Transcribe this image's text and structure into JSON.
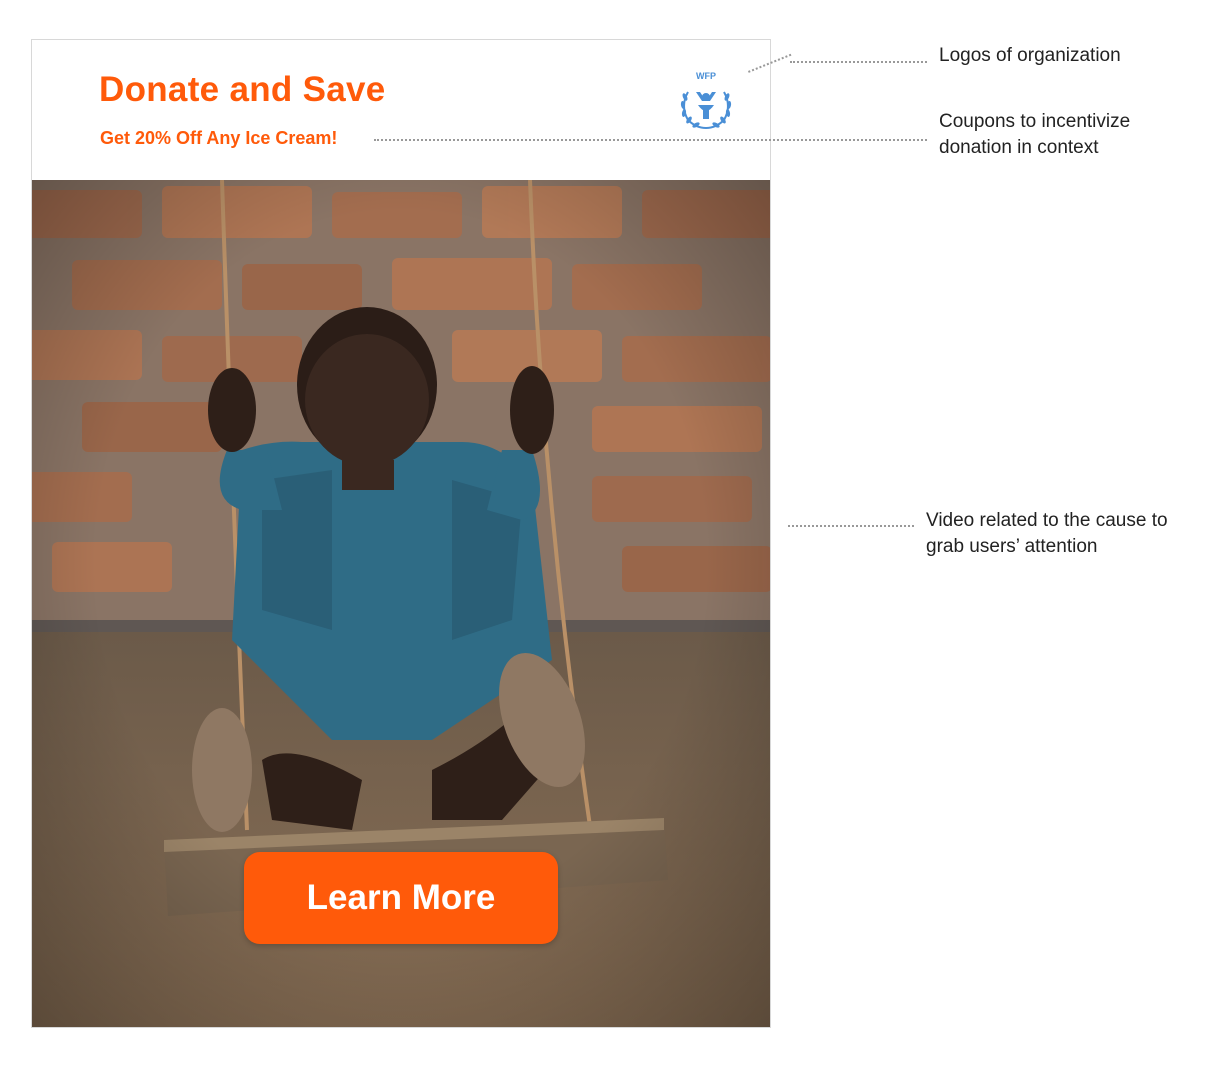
{
  "ad": {
    "title": "Donate and Save",
    "coupon": "Get 20% Off Any Ice Cream!",
    "logo_text": "WFP",
    "cta_label": "Learn More"
  },
  "annotations": {
    "logos": "Logos of organization",
    "coupons_line1": "Coupons to incentivize",
    "coupons_line2": "donation in context",
    "video_line1": "Video related to the cause to",
    "video_line2": "grab users’ attention"
  },
  "colors": {
    "accent": "#ff5a0a",
    "logo_blue": "#4a8fd6"
  },
  "icons": {
    "logo": "wfp-wreath-logo-icon"
  }
}
